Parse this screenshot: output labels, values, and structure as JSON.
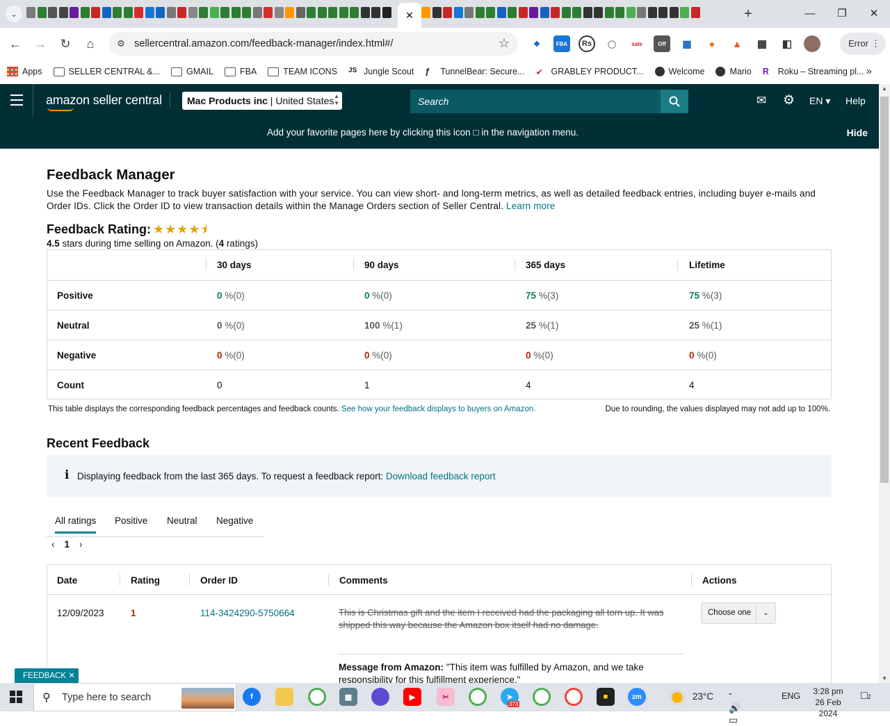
{
  "browser": {
    "url": "sellercentral.amazon.com/feedback-manager/index.html#/",
    "profile_status": "Error",
    "new_tab": "+",
    "bookmarks": [
      {
        "label": "Apps",
        "icon": "apps-grid-icon"
      },
      {
        "label": "SELLER CENTRAL &...",
        "icon": "folder-icon"
      },
      {
        "label": "GMAIL",
        "icon": "folder-icon"
      },
      {
        "label": "FBA",
        "icon": "folder-icon"
      },
      {
        "label": "TEAM ICONS",
        "icon": "folder-icon"
      },
      {
        "label": "Jungle Scout",
        "icon": "junglescout-icon"
      },
      {
        "label": "TunnelBear: Secure...",
        "icon": "tunnelbear-icon"
      },
      {
        "label": "GRABLEY PRODUCT...",
        "icon": "checkmark-icon"
      },
      {
        "label": "Welcome",
        "icon": "globe-icon"
      },
      {
        "label": "Mario",
        "icon": "globe-icon"
      },
      {
        "label": "Roku – Streaming pl...",
        "icon": "roku-icon"
      }
    ],
    "tab_favicon_colors": [
      "#7a7a7a",
      "#2e7d32",
      "#555",
      "#444",
      "#6a1b9a",
      "#2e7d32",
      "#c62828",
      "#1565c0",
      "#2e7d32",
      "#2e7d32",
      "#d32f2f",
      "#1976d2",
      "#1565c0",
      "#777",
      "#c62828",
      "#888",
      "#2e7d32",
      "#4caf50",
      "#2e7d32",
      "#2e7d32",
      "#2e7d32",
      "#777",
      "#d32f2f",
      "#888",
      "#ff9800",
      "#666",
      "#2e7d32",
      "#2e7d32",
      "#2e7d32",
      "#2e7d32",
      "#2e7d32",
      "#333",
      "#333",
      "#222"
    ],
    "tab_favicon_colors_right": [
      "#ff9800",
      "#333",
      "#c62828",
      "#1976d2",
      "#777",
      "#2e7d32",
      "#2e7d32",
      "#1565c0",
      "#2e7d32",
      "#c62828",
      "#6a1b9a",
      "#1565c0",
      "#c62828",
      "#2e7d32",
      "#2e7d32",
      "#333",
      "#333",
      "#2e7d32",
      "#2e7d32",
      "#4caf50",
      "#777",
      "#333",
      "#333",
      "#333",
      "#4caf50",
      "#c62828"
    ]
  },
  "header": {
    "logo": "amazon seller central",
    "account_name": "Mac Products inc",
    "account_region": "United States",
    "search_placeholder": "Search",
    "language": "EN",
    "help": "Help",
    "favorites_banner": "Add your favorite pages here by clicking this icon",
    "favorites_banner_suffix": "in the navigation menu.",
    "hide": "Hide"
  },
  "page": {
    "title": "Feedback Manager",
    "intro": "Use the Feedback Manager to track buyer satisfaction with your service. You can view short- and long-term metrics, as well as detailed feedback entries, including buyer e-mails and Order IDs. Click the Order ID to view transaction details within the Manage Orders section of Seller Central.",
    "learn_more": "Learn more",
    "rating_title": "Feedback Rating:",
    "rating_value": 4.5,
    "rating_value_text": "4.5",
    "rating_sub_middle": "stars during time selling on Amazon. (",
    "rating_count": "4",
    "rating_sub_end": "ratings)"
  },
  "metrics": {
    "columns": [
      "30 days",
      "90 days",
      "365 days",
      "Lifetime"
    ],
    "rows": [
      {
        "label": "Positive",
        "cells": [
          {
            "v": "0",
            "c": "(0)"
          },
          {
            "v": "0",
            "c": "(0)"
          },
          {
            "v": "75",
            "c": "(3)"
          },
          {
            "v": "75",
            "c": "(3)"
          }
        ]
      },
      {
        "label": "Neutral",
        "cells": [
          {
            "v": "0",
            "c": "(0)"
          },
          {
            "v": "100",
            "c": "(1)"
          },
          {
            "v": "25",
            "c": "(1)"
          },
          {
            "v": "25",
            "c": "(1)"
          }
        ]
      },
      {
        "label": "Negative",
        "cells": [
          {
            "v": "0",
            "c": "(0)"
          },
          {
            "v": "0",
            "c": "(0)"
          },
          {
            "v": "0",
            "c": "(0)"
          },
          {
            "v": "0",
            "c": "(0)"
          }
        ]
      },
      {
        "label": "Count",
        "cells": [
          {
            "v": "0"
          },
          {
            "v": "1"
          },
          {
            "v": "4"
          },
          {
            "v": "4"
          }
        ]
      }
    ],
    "pct_sign": "%",
    "note": "This table displays the corresponding feedback percentages and feedback counts.",
    "note_link": "See how your feedback displays to buyers on Amazon.",
    "rounding_note": "Due to rounding, the values displayed may not add up to 100%."
  },
  "recent": {
    "title": "Recent Feedback",
    "info": "Displaying feedback from the last 365 days. To request a feedback report:",
    "info_link": "Download feedback report",
    "tabs": [
      "All ratings",
      "Positive",
      "Neutral",
      "Negative"
    ],
    "page": "1",
    "table_headers": [
      "Date",
      "Rating",
      "Order ID",
      "Comments",
      "Actions"
    ],
    "rows": [
      {
        "date": "12/09/2023",
        "rating": "1",
        "order_id": "114-3424290-5750664",
        "comment": "This is Christmas gift and the item I received had the packaging all torn up. It was shipped this way because the Amazon box itself had no damage.",
        "message_label": "Message from Amazon:",
        "message": "\"This item was fulfilled by Amazon, and we take responsibility for this fulfillment experience.\"",
        "action": "Choose one"
      }
    ],
    "feedback_pill": "FEEDBACK"
  },
  "taskbar": {
    "search_placeholder": "Type here to search",
    "temperature": "23°C",
    "language": "ENG",
    "time": "3:28 pm",
    "date": "26 Feb 2024",
    "notifications": "2",
    "telegram_badge": "373"
  },
  "colors": {
    "header_bg": "#002f36",
    "link": "#007185",
    "positive": "#067d62",
    "negative": "#b12704",
    "star": "#e8a10c"
  }
}
